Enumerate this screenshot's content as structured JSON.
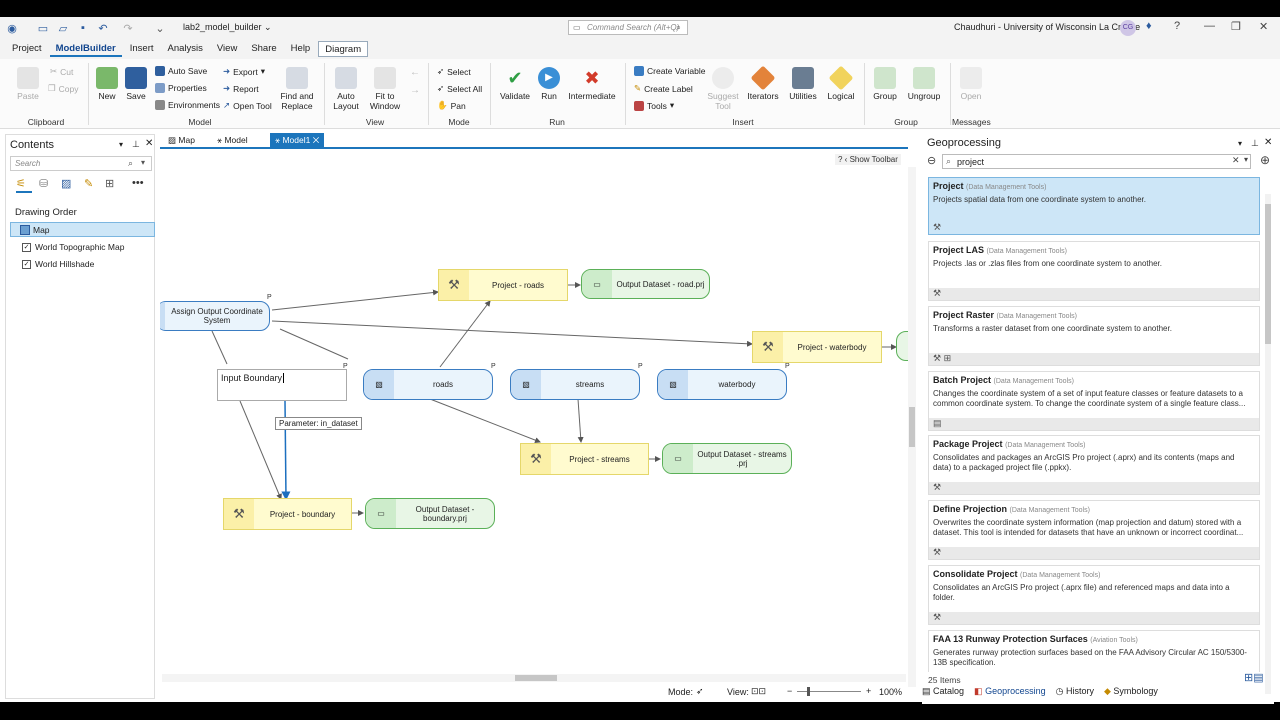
{
  "titlebar": {
    "project_name": "lab2_model_builder ⌄",
    "command_search": "Command Search (Alt+Q)",
    "user": "Chaudhuri - University of Wisconsin La Crosse",
    "avatar": "CG"
  },
  "menu": [
    "Project",
    "ModelBuilder",
    "Insert",
    "Analysis",
    "View",
    "Share",
    "Help",
    "Diagram"
  ],
  "ribbon": {
    "clipboard": {
      "paste": "Paste",
      "cut": "Cut",
      "copy": "Copy",
      "group": "Clipboard"
    },
    "model": {
      "new": "New",
      "save": "Save",
      "auto_save": "Auto Save",
      "properties": "Properties",
      "environments": "Environments",
      "export": "Export",
      "report": "Report",
      "open_tool": "Open Tool",
      "find_replace": "Find and Replace",
      "group": "Model"
    },
    "view": {
      "auto_layout": "Auto Layout",
      "fit_window": "Fit to Window",
      "group": "View"
    },
    "mode": {
      "select": "Select",
      "select_all": "Select All",
      "pan": "Pan",
      "group": "Mode"
    },
    "run": {
      "validate": "Validate",
      "run": "Run",
      "intermediate": "Intermediate",
      "group": "Run"
    },
    "insert": {
      "create_variable": "Create Variable",
      "create_label": "Create Label",
      "tools": "Tools",
      "suggest_tool": "Suggest Tool",
      "iterators": "Iterators",
      "utilities": "Utilities",
      "logical": "Logical",
      "group": "Insert"
    },
    "group_grp": {
      "group": "Group",
      "ungroup": "Ungroup",
      "label": "Group"
    },
    "messages": {
      "open": "Open",
      "label": "Messages"
    }
  },
  "contents": {
    "title": "Contents",
    "search_placeholder": "Search",
    "drawing_order": "Drawing Order",
    "layers": [
      "Map",
      "World Topographic Map",
      "World Hillshade"
    ]
  },
  "tabs": [
    "Map",
    "Model",
    "Model1"
  ],
  "show_toolbar": "Show Toolbar",
  "diagram": {
    "assign": "Assign Output Coordinate System",
    "project_roads": "Project - roads",
    "output_road": "Output Dataset - road.prj",
    "project_waterbody": "Project - waterbody",
    "input_boundary": "Input Boundary",
    "tooltip": "Parameter: in_dataset",
    "roads": "roads",
    "streams": "streams",
    "waterbody": "waterbody",
    "project_streams": "Project - streams",
    "output_streams": "Output Dataset - streams .prj",
    "project_boundary": "Project - boundary",
    "output_boundary": "Output Dataset - boundary.prj",
    "p": "P"
  },
  "canvas_status": {
    "mode": "Mode:",
    "view": "View:",
    "zoom": "100%"
  },
  "geoprocessing": {
    "title": "Geoprocessing",
    "search_value": "project",
    "items": [
      {
        "name": "Project",
        "toolbox": "(Data Management Tools)",
        "desc": "Projects spatial data from one coordinate system to another."
      },
      {
        "name": "Project LAS",
        "toolbox": "(Data Management Tools)",
        "desc": "Projects .las or .zlas files from one coordinate system to another."
      },
      {
        "name": "Project Raster",
        "toolbox": "(Data Management Tools)",
        "desc": "Transforms a raster dataset from one coordinate system to another."
      },
      {
        "name": "Batch Project",
        "toolbox": "(Data Management Tools)",
        "desc": "Changes the coordinate system of a set of input feature classes or feature datasets to a common coordinate system. To change the coordinate system of a single feature class..."
      },
      {
        "name": "Package Project",
        "toolbox": "(Data Management Tools)",
        "desc": "Consolidates and packages an ArcGIS Pro project (.aprx) and its contents (maps and data) to a packaged project file (.ppkx)."
      },
      {
        "name": "Define Projection",
        "toolbox": "(Data Management Tools)",
        "desc": "Overwrites the coordinate system information (map projection and datum) stored with a dataset. This tool is intended for datasets that have an unknown or incorrect coordinat..."
      },
      {
        "name": "Consolidate Project",
        "toolbox": "(Data Management Tools)",
        "desc": "Consolidates an ArcGIS Pro project (.aprx file) and referenced maps and data into a folder."
      },
      {
        "name": "FAA 13 Runway Protection Surfaces",
        "toolbox": "(Aviation Tools)",
        "desc": "Generates runway protection surfaces based on the FAA Advisory Circular AC 150/5300-13B specification."
      }
    ],
    "count": "25 Items",
    "bottom_tabs": [
      "Catalog",
      "Geoprocessing",
      "History",
      "Symbology"
    ]
  }
}
